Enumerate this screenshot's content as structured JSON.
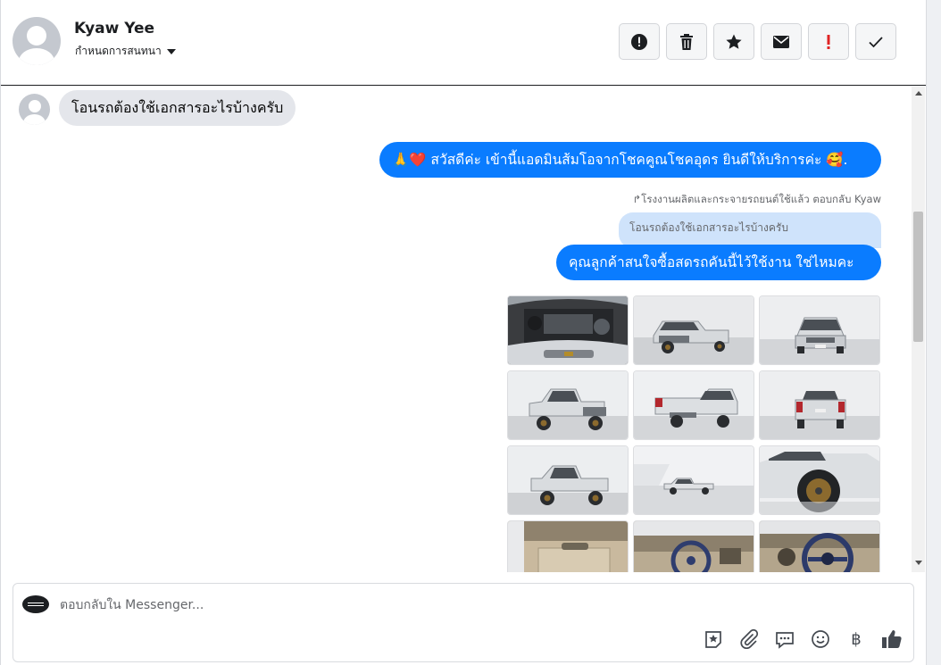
{
  "header": {
    "user_name": "Kyaw Yee",
    "conversation_settings": "กำหนดการสนทนา",
    "toolbar": [
      {
        "icon": "alert-circle-icon",
        "color": "#1c1e21"
      },
      {
        "icon": "trash-icon",
        "color": "#1c1e21"
      },
      {
        "icon": "star-icon",
        "color": "#1c1e21"
      },
      {
        "icon": "envelope-icon",
        "color": "#1c1e21"
      },
      {
        "icon": "exclamation-icon",
        "color": "#e02424"
      },
      {
        "icon": "check-icon",
        "color": "#1c1e21"
      }
    ]
  },
  "messages": {
    "incoming_1": "โอนรถต้องใช้เอกสารอะไรบ้างครับ",
    "outgoing_1": "🙏❤️ สวัสดีค่ะ เข้านี้แอดมินส้มโอจากโชคคูณโชคอุดร ยินดีให้บริการค่ะ 🥰.",
    "reply_meta": "โรงงานผลิตและกระจายรถยนต์ใช้แล้ว ตอบกลับ Kyaw",
    "quoted_text": "โอนรถต้องใช้เอกสารอะไรบ้างครับ",
    "outgoing_2": "คุณลูกค้าสนใจซื้อสดรถคันนี้ไว้ใช้งาน ใช่ไหมคะ"
  },
  "gallery": {
    "photos": [
      {
        "subject": "engine-bay"
      },
      {
        "subject": "front-left"
      },
      {
        "subject": "front"
      },
      {
        "subject": "left-side"
      },
      {
        "subject": "rear-quarter"
      },
      {
        "subject": "rear"
      },
      {
        "subject": "side-angle"
      },
      {
        "subject": "side-distant"
      },
      {
        "subject": "wheel-close"
      },
      {
        "subject": "door-panel"
      },
      {
        "subject": "dashboard"
      },
      {
        "subject": "steering-wheel"
      }
    ]
  },
  "composer": {
    "placeholder": "ตอบกลับใน Messenger...",
    "tools": [
      "sticker-star-icon",
      "paperclip-icon",
      "saved-reply-icon",
      "emoji-icon",
      "baht-icon",
      "thumbs-up-icon"
    ],
    "baht_symbol": "฿",
    "accent": "#0a7cff"
  }
}
